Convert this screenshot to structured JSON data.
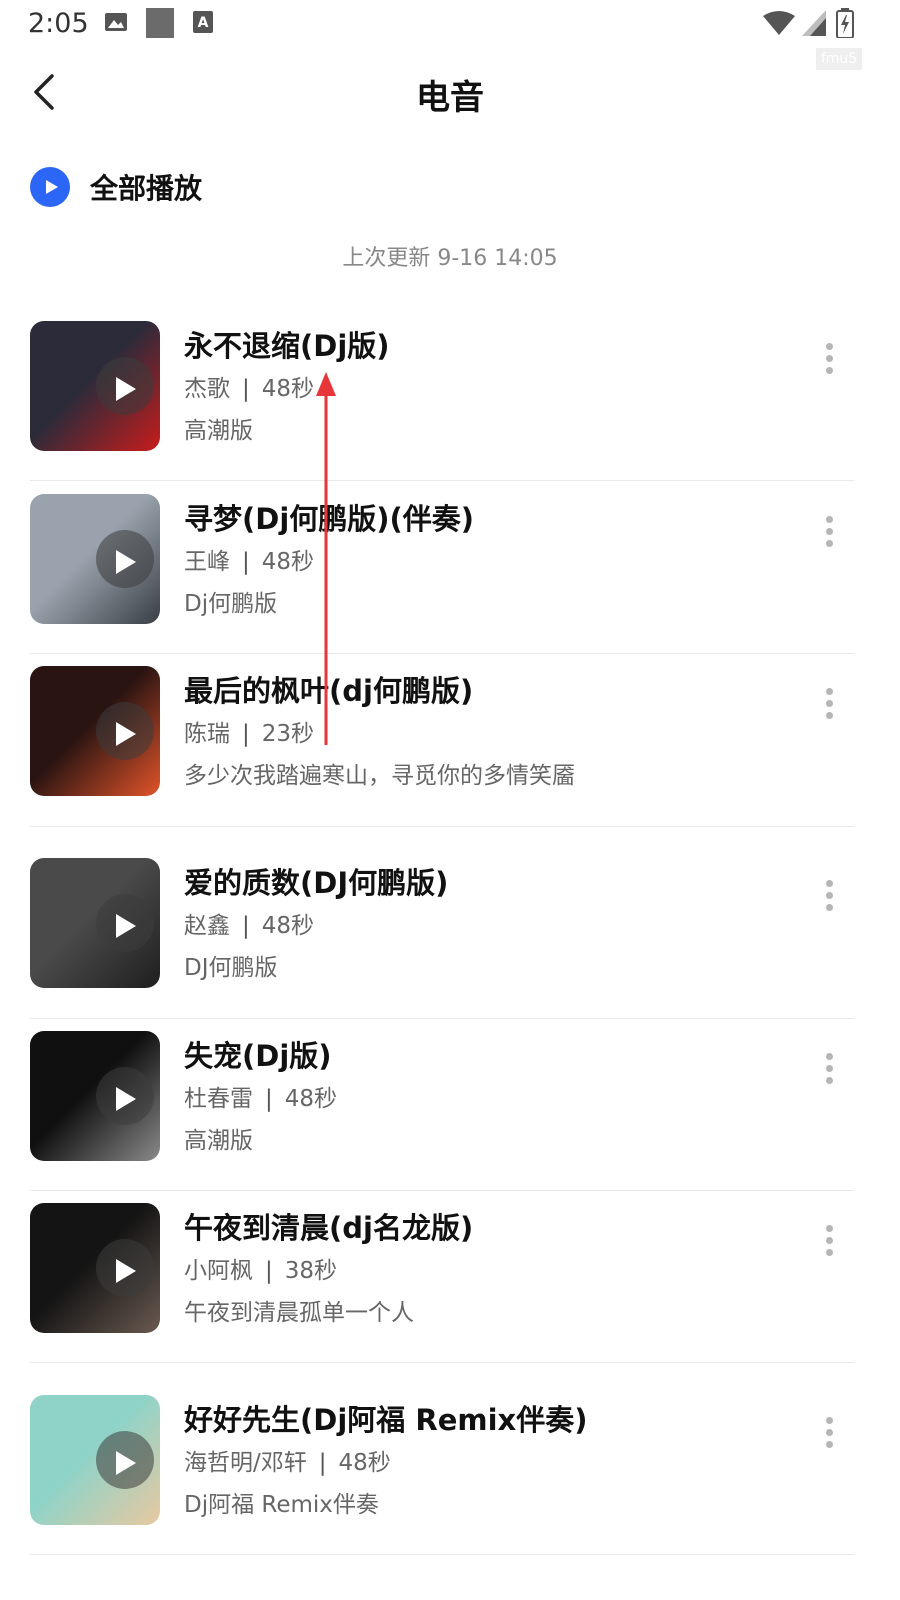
{
  "status_bar": {
    "time": "2:05",
    "icons": [
      "image-icon",
      "square-icon",
      "a-icon",
      "wifi-icon",
      "signal-icon",
      "battery-icon"
    ],
    "watermark": "fmu5"
  },
  "header": {
    "title": "电音",
    "back_icon": "back-chevron-icon"
  },
  "play_all": {
    "label": "全部播放",
    "icon": "play-circle-icon",
    "color": "#2b66f6"
  },
  "update_time": "上次更新 9-16 14:05",
  "songs": [
    {
      "title": "永不退缩(Dj版)",
      "artist": "杰歌",
      "duration": "48秒",
      "subtitle": "高潮版",
      "cover_colors": [
        "#2b2b3a",
        "#c81c1c"
      ]
    },
    {
      "title": "寻梦(Dj何鹏版)(伴奏)",
      "artist": "王峰",
      "duration": "48秒",
      "subtitle": "Dj何鹏版",
      "cover_colors": [
        "#9aa3ad",
        "#3a3f46"
      ]
    },
    {
      "title": "最后的枫叶(dj何鹏版)",
      "artist": "陈瑞",
      "duration": "23秒",
      "subtitle": "多少次我踏遍寒山，寻觅你的多情笑靥",
      "cover_colors": [
        "#2a1412",
        "#e2542a"
      ]
    },
    {
      "title": "爱的质数(DJ何鹏版)",
      "artist": "赵鑫",
      "duration": "48秒",
      "subtitle": "DJ何鹏版",
      "cover_colors": [
        "#4a4a4a",
        "#1f1f1f"
      ]
    },
    {
      "title": "失宠(Dj版)",
      "artist": "杜春雷",
      "duration": "48秒",
      "subtitle": "高潮版",
      "cover_colors": [
        "#101010",
        "#8a8a8a"
      ]
    },
    {
      "title": "午夜到清晨(dj名龙版)",
      "artist": "小阿枫",
      "duration": "38秒",
      "subtitle": "午夜到清晨孤单一个人",
      "cover_colors": [
        "#141414",
        "#6a5a50"
      ]
    },
    {
      "title": "好好先生(Dj阿福 Remix伴奏)",
      "artist": "海哲明/邓轩",
      "duration": "48秒",
      "subtitle": "Dj阿福 Remix伴奏",
      "cover_colors": [
        "#8fd3c8",
        "#e8c8a0"
      ]
    }
  ],
  "annotation": {
    "color": "#e8353a"
  }
}
